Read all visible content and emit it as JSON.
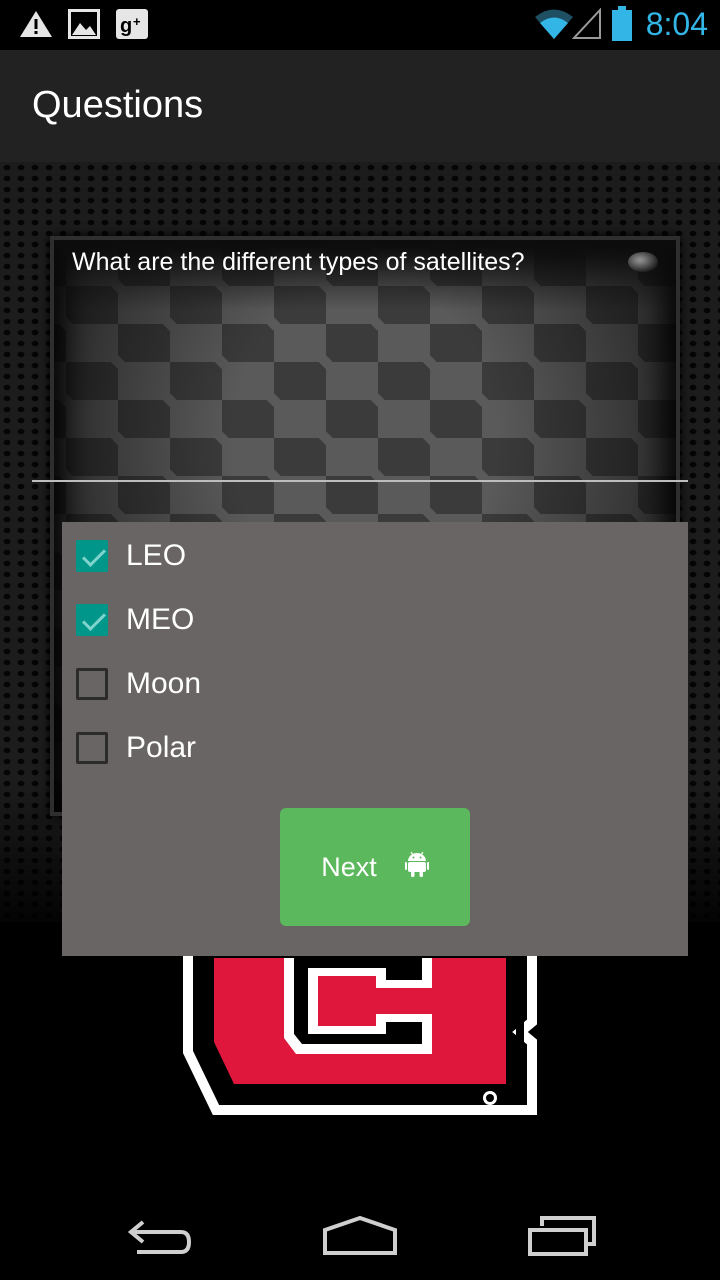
{
  "status_bar": {
    "time": "8:04",
    "time_color": "#33b5e5",
    "icons": [
      "warning-icon",
      "image-icon",
      "google-plus-icon",
      "wifi-icon",
      "signal-icon",
      "battery-icon"
    ]
  },
  "action_bar": {
    "title": "Questions"
  },
  "question": {
    "text": "What are the different types of satellites?"
  },
  "options": [
    {
      "label": "LEO",
      "checked": true
    },
    {
      "label": "MEO",
      "checked": true
    },
    {
      "label": "Moon",
      "checked": false
    },
    {
      "label": "Polar",
      "checked": false
    }
  ],
  "next_button": {
    "label": "Next",
    "color": "#5cb85c",
    "icon": "android-icon"
  },
  "colors": {
    "panel": "#696564",
    "checkbox_checked": "#00968a",
    "logo_red": "#e0173c"
  },
  "nav_bar": {
    "icons": [
      "back-icon",
      "home-icon",
      "recent-apps-icon"
    ]
  }
}
